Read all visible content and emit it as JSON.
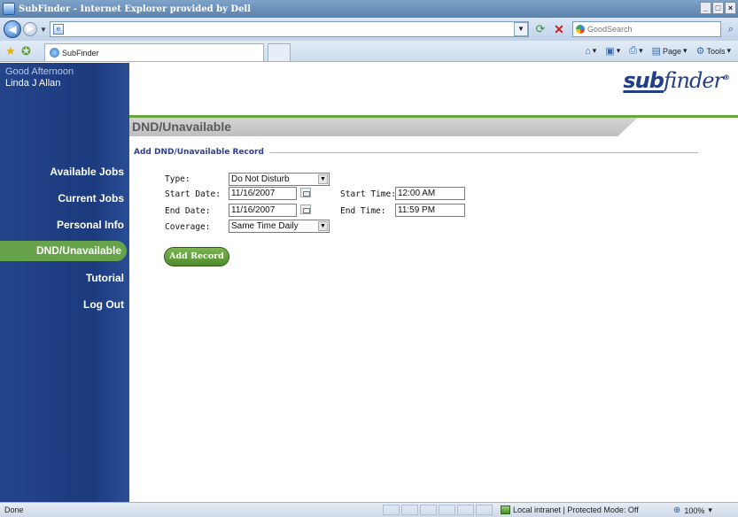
{
  "browser": {
    "window_title": "SubFinder - Internet Explorer provided by Dell",
    "window_buttons": [
      "_",
      "□",
      "×"
    ],
    "address_value": "",
    "search_placeholder": "GoodSearch",
    "tab_label": "SubFinder",
    "commands": {
      "home_icon": "home-icon",
      "feeds_icon": "feeds-icon",
      "print_icon": "print-icon",
      "page_label": "Page",
      "tools_label": "Tools"
    }
  },
  "sidebar": {
    "greeting": "Good Afternoon",
    "user_name": "Linda J Allan",
    "items": [
      {
        "label": "Available Jobs"
      },
      {
        "label": "Current Jobs"
      },
      {
        "label": "Personal Info"
      },
      {
        "label": "DND/Unavailable",
        "active": true
      },
      {
        "label": "Tutorial"
      },
      {
        "label": "Log Out"
      }
    ]
  },
  "logo": {
    "sub": "sub",
    "finder": "finder",
    "reg": "®"
  },
  "section_title": "DND/Unavailable",
  "form": {
    "legend": "Add DND/Unavailable Record",
    "type_label": "Type:",
    "type_value": "Do Not Disturb",
    "start_date_label": "Start Date:",
    "start_date_value": "11/16/2007",
    "start_time_label": "Start Time:",
    "start_time_value": "12:00 AM",
    "end_date_label": "End Date:",
    "end_date_value": "11/16/2007",
    "end_time_label": "End Time:",
    "end_time_value": "11:59 PM",
    "coverage_label": "Coverage:",
    "coverage_value": "Same Time Daily",
    "submit_label": "Add Record"
  },
  "status": {
    "left_text": "Done",
    "zone_text": "Local intranet | Protected Mode: Off",
    "zoom_text": "100%"
  },
  "colors": {
    "sidebar_bg": "#1c3a7e",
    "active_green": "#66a34a",
    "accent_line": "#6ba53e",
    "legend_blue": "#2b3f9a"
  }
}
